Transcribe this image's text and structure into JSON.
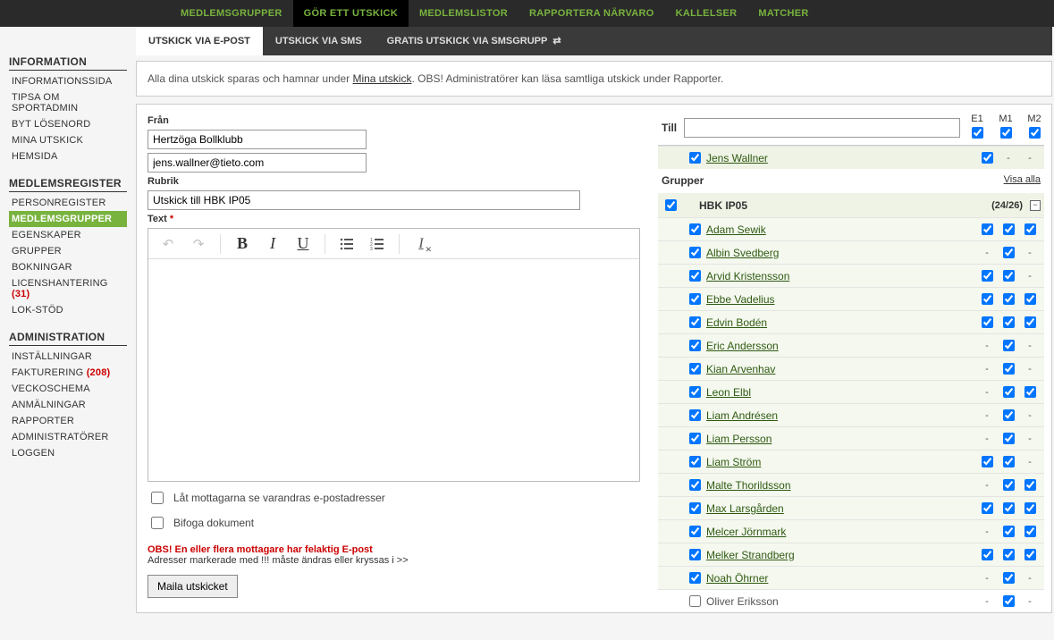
{
  "topnav": {
    "items": [
      {
        "label": "MEDLEMSGRUPPER"
      },
      {
        "label": "GÖR ETT UTSKICK"
      },
      {
        "label": "MEDLEMSLISTOR"
      },
      {
        "label": "RAPPORTERA NÄRVARO"
      },
      {
        "label": "KALLELSER"
      },
      {
        "label": "MATCHER"
      }
    ],
    "active": 1
  },
  "sidebar": {
    "sections": [
      {
        "heading": "INFORMATION",
        "items": [
          {
            "label": "INFORMATIONSSIDA"
          },
          {
            "label": "TIPSA OM SPORTADMIN"
          },
          {
            "label": "BYT LÖSENORD"
          },
          {
            "label": "MINA UTSKICK"
          },
          {
            "label": "HEMSIDA"
          }
        ]
      },
      {
        "heading": "MEDLEMSREGISTER",
        "items": [
          {
            "label": "PERSONREGISTER"
          },
          {
            "label": "MEDLEMSGRUPPER",
            "active": true
          },
          {
            "label": "EGENSKAPER"
          },
          {
            "label": "GRUPPER"
          },
          {
            "label": "BOKNINGAR"
          },
          {
            "label": "LICENSHANTERING",
            "badge": "31"
          },
          {
            "label": "LOK-STÖD"
          }
        ]
      },
      {
        "heading": "ADMINISTRATION",
        "items": [
          {
            "label": "INSTÄLLNINGAR"
          },
          {
            "label": "FAKTURERING",
            "badge": "208"
          },
          {
            "label": "VECKOSCHEMA"
          },
          {
            "label": "ANMÄLNINGAR"
          },
          {
            "label": "RAPPORTER"
          },
          {
            "label": "ADMINISTRATÖRER"
          },
          {
            "label": "LOGGEN"
          }
        ]
      }
    ]
  },
  "subtabs": {
    "items": [
      {
        "label": "UTSKICK VIA E-POST"
      },
      {
        "label": "UTSKICK VIA SMS"
      },
      {
        "label": "GRATIS UTSKICK VIA SMSGRUPP",
        "icon": true
      }
    ],
    "active": 0
  },
  "notice": {
    "pre": "Alla dina utskick sparas och hamnar under ",
    "link": "Mina utskick",
    "post": ". OBS! Administratörer kan läsa samtliga utskick under Rapporter."
  },
  "form": {
    "from_label": "Från",
    "from_name": "Hertzöga Bollklubb",
    "from_email": "jens.wallner@tieto.com",
    "subject_label": "Rubrik",
    "subject_value": "Utskick till HBK IP05",
    "body_label": "Text",
    "body_value": "",
    "chk_showrecipients": "Låt mottagarna se varandras e-postadresser",
    "chk_attach": "Bifoga dokument",
    "warn_line1": "OBS! En eller flera mottagare har felaktig E-post",
    "warn_line2": "Adresser markerade med !!! måste ändras eller kryssas i >>",
    "send_label": "Maila utskicket"
  },
  "recipients": {
    "till_label": "Till",
    "cols": [
      "E1",
      "M1",
      "M2"
    ],
    "self": {
      "name": "Jens Wallner",
      "e1": true,
      "m1": "-",
      "m2": "-"
    },
    "groups_heading": "Grupper",
    "showall": "Visa alla",
    "group": {
      "name": "HBK IP05",
      "count": "(24/26)"
    },
    "people": [
      {
        "name": "Adam Sewik",
        "e1": true,
        "m1": true,
        "m2": true
      },
      {
        "name": "Albin Svedberg",
        "e1": "-",
        "m1": true,
        "m2": "-"
      },
      {
        "name": "Arvid Kristensson",
        "e1": true,
        "m1": true,
        "m2": "-"
      },
      {
        "name": "Ebbe Vadelius",
        "e1": true,
        "m1": true,
        "m2": true
      },
      {
        "name": "Edvin Bodén",
        "e1": true,
        "m1": true,
        "m2": true
      },
      {
        "name": "Eric Andersson",
        "e1": "-",
        "m1": true,
        "m2": "-"
      },
      {
        "name": "Kian Arvenhav",
        "e1": "-",
        "m1": true,
        "m2": "-"
      },
      {
        "name": "Leon Elbl",
        "e1": "-",
        "m1": true,
        "m2": true
      },
      {
        "name": "Liam Andrésen",
        "e1": "-",
        "m1": true,
        "m2": "-"
      },
      {
        "name": "Liam Persson",
        "e1": "-",
        "m1": true,
        "m2": "-"
      },
      {
        "name": "Liam Ström",
        "e1": true,
        "m1": true,
        "m2": "-"
      },
      {
        "name": "Malte Thorildsson",
        "e1": "-",
        "m1": true,
        "m2": true
      },
      {
        "name": "Max Larsgården",
        "e1": true,
        "m1": true,
        "m2": true
      },
      {
        "name": "Melcer Jörnmark",
        "e1": "-",
        "m1": true,
        "m2": true
      },
      {
        "name": "Melker Strandberg",
        "e1": true,
        "m1": true,
        "m2": true
      },
      {
        "name": "Noah Öhrner",
        "e1": "-",
        "m1": true,
        "m2": "-"
      },
      {
        "name": "Oliver Eriksson",
        "e1": "-",
        "m1": true,
        "m2": "-",
        "unchecked": true
      }
    ]
  }
}
